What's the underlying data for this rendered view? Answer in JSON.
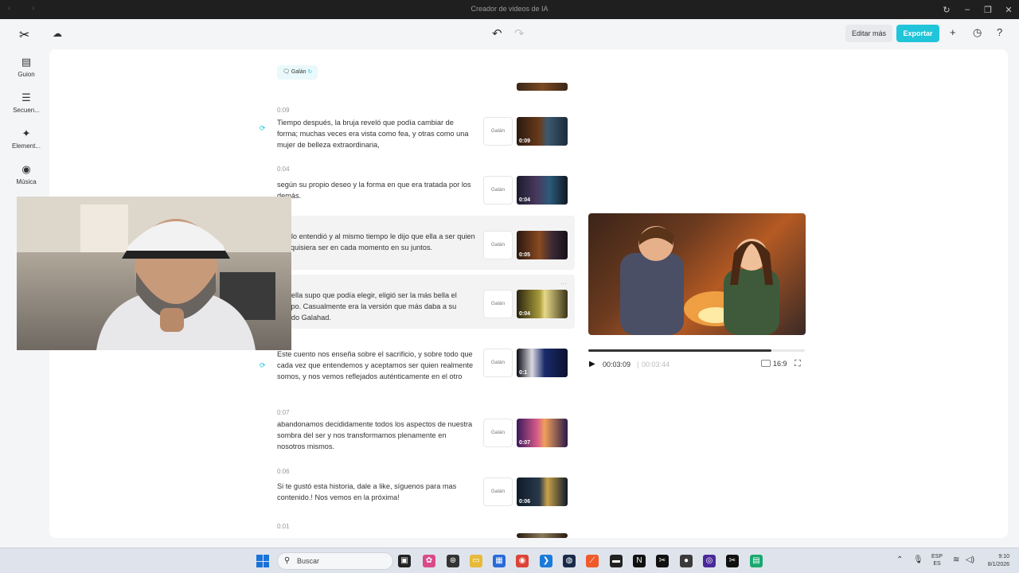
{
  "window": {
    "title": "Creador de videos de IA"
  },
  "toolbar": {
    "edit_more": "Editar más",
    "export": "Exportar"
  },
  "sidebar": {
    "items": [
      {
        "label": "Guion",
        "icon": "script-icon"
      },
      {
        "label": "Secuen...",
        "icon": "sequence-icon"
      },
      {
        "label": "Element...",
        "icon": "elements-icon"
      },
      {
        "label": "Música",
        "icon": "music-icon"
      }
    ]
  },
  "voice_chip": {
    "label": "Galán"
  },
  "scenes": [
    {
      "time": "0:09",
      "text": "Tiempo después, la bruja reveló que podía cambiar de forma; muchas veces era vista como fea, y otras como una mujer de belleza extraordinaria,",
      "voice": "Galán",
      "duration": "0:09"
    },
    {
      "time": "0:04",
      "text": "según su propio deseo y la forma en que era tratada por los demás.",
      "voice": "Galán",
      "duration": "0:04"
    },
    {
      "time": "",
      "text": "had lo entendió y al mismo tiempo le dijo que ella a ser quien ella quisiera ser en cada momento en su juntos.",
      "voice": "Galán",
      "duration": "0:05"
    },
    {
      "time": "",
      "text": "ndo ella supo que podía elegir, eligió ser la más bella el tiempo. Casualmente era la versión que más daba a su amado Galahad.",
      "voice": "Galán",
      "duration": "0:04"
    },
    {
      "time": "",
      "text": "Este cuento nos enseña sobre el sacrificio, y sobre todo que cada vez que entendemos y aceptamos ser quien realmente somos, y nos vemos reflejados auténticamente en el otro",
      "voice": "Galán",
      "duration": "0:1"
    },
    {
      "time": "0:07",
      "text": "abandonamos decididamente todos los aspectos de nuestra sombra del ser y nos transformamos plenamente en nosotros mismos.",
      "voice": "Galán",
      "duration": "0:07"
    },
    {
      "time": "0:06",
      "text": "Si te gustó esta historia, dale a like, síguenos para mas contenido.! Nos vemos en la próxima!",
      "voice": "Galán",
      "duration": "0:06"
    },
    {
      "time": "0:01",
      "text": "",
      "voice": "",
      "duration": ""
    }
  ],
  "player": {
    "current_time": "00:03:09",
    "separator": "|",
    "total_time": "00:03:44",
    "progress": 0.845,
    "aspect_ratio": "16:9"
  },
  "taskbar": {
    "search_placeholder": "Buscar",
    "lang_top": "ESP",
    "lang_bottom": "ES",
    "time": "9:10",
    "date": "8/1/2026"
  },
  "colors": {
    "accent": "#20c5d9",
    "panel_bg": "#ffffff",
    "app_bg": "#f4f5f7",
    "titlebar_bg": "#1f1f1f"
  }
}
